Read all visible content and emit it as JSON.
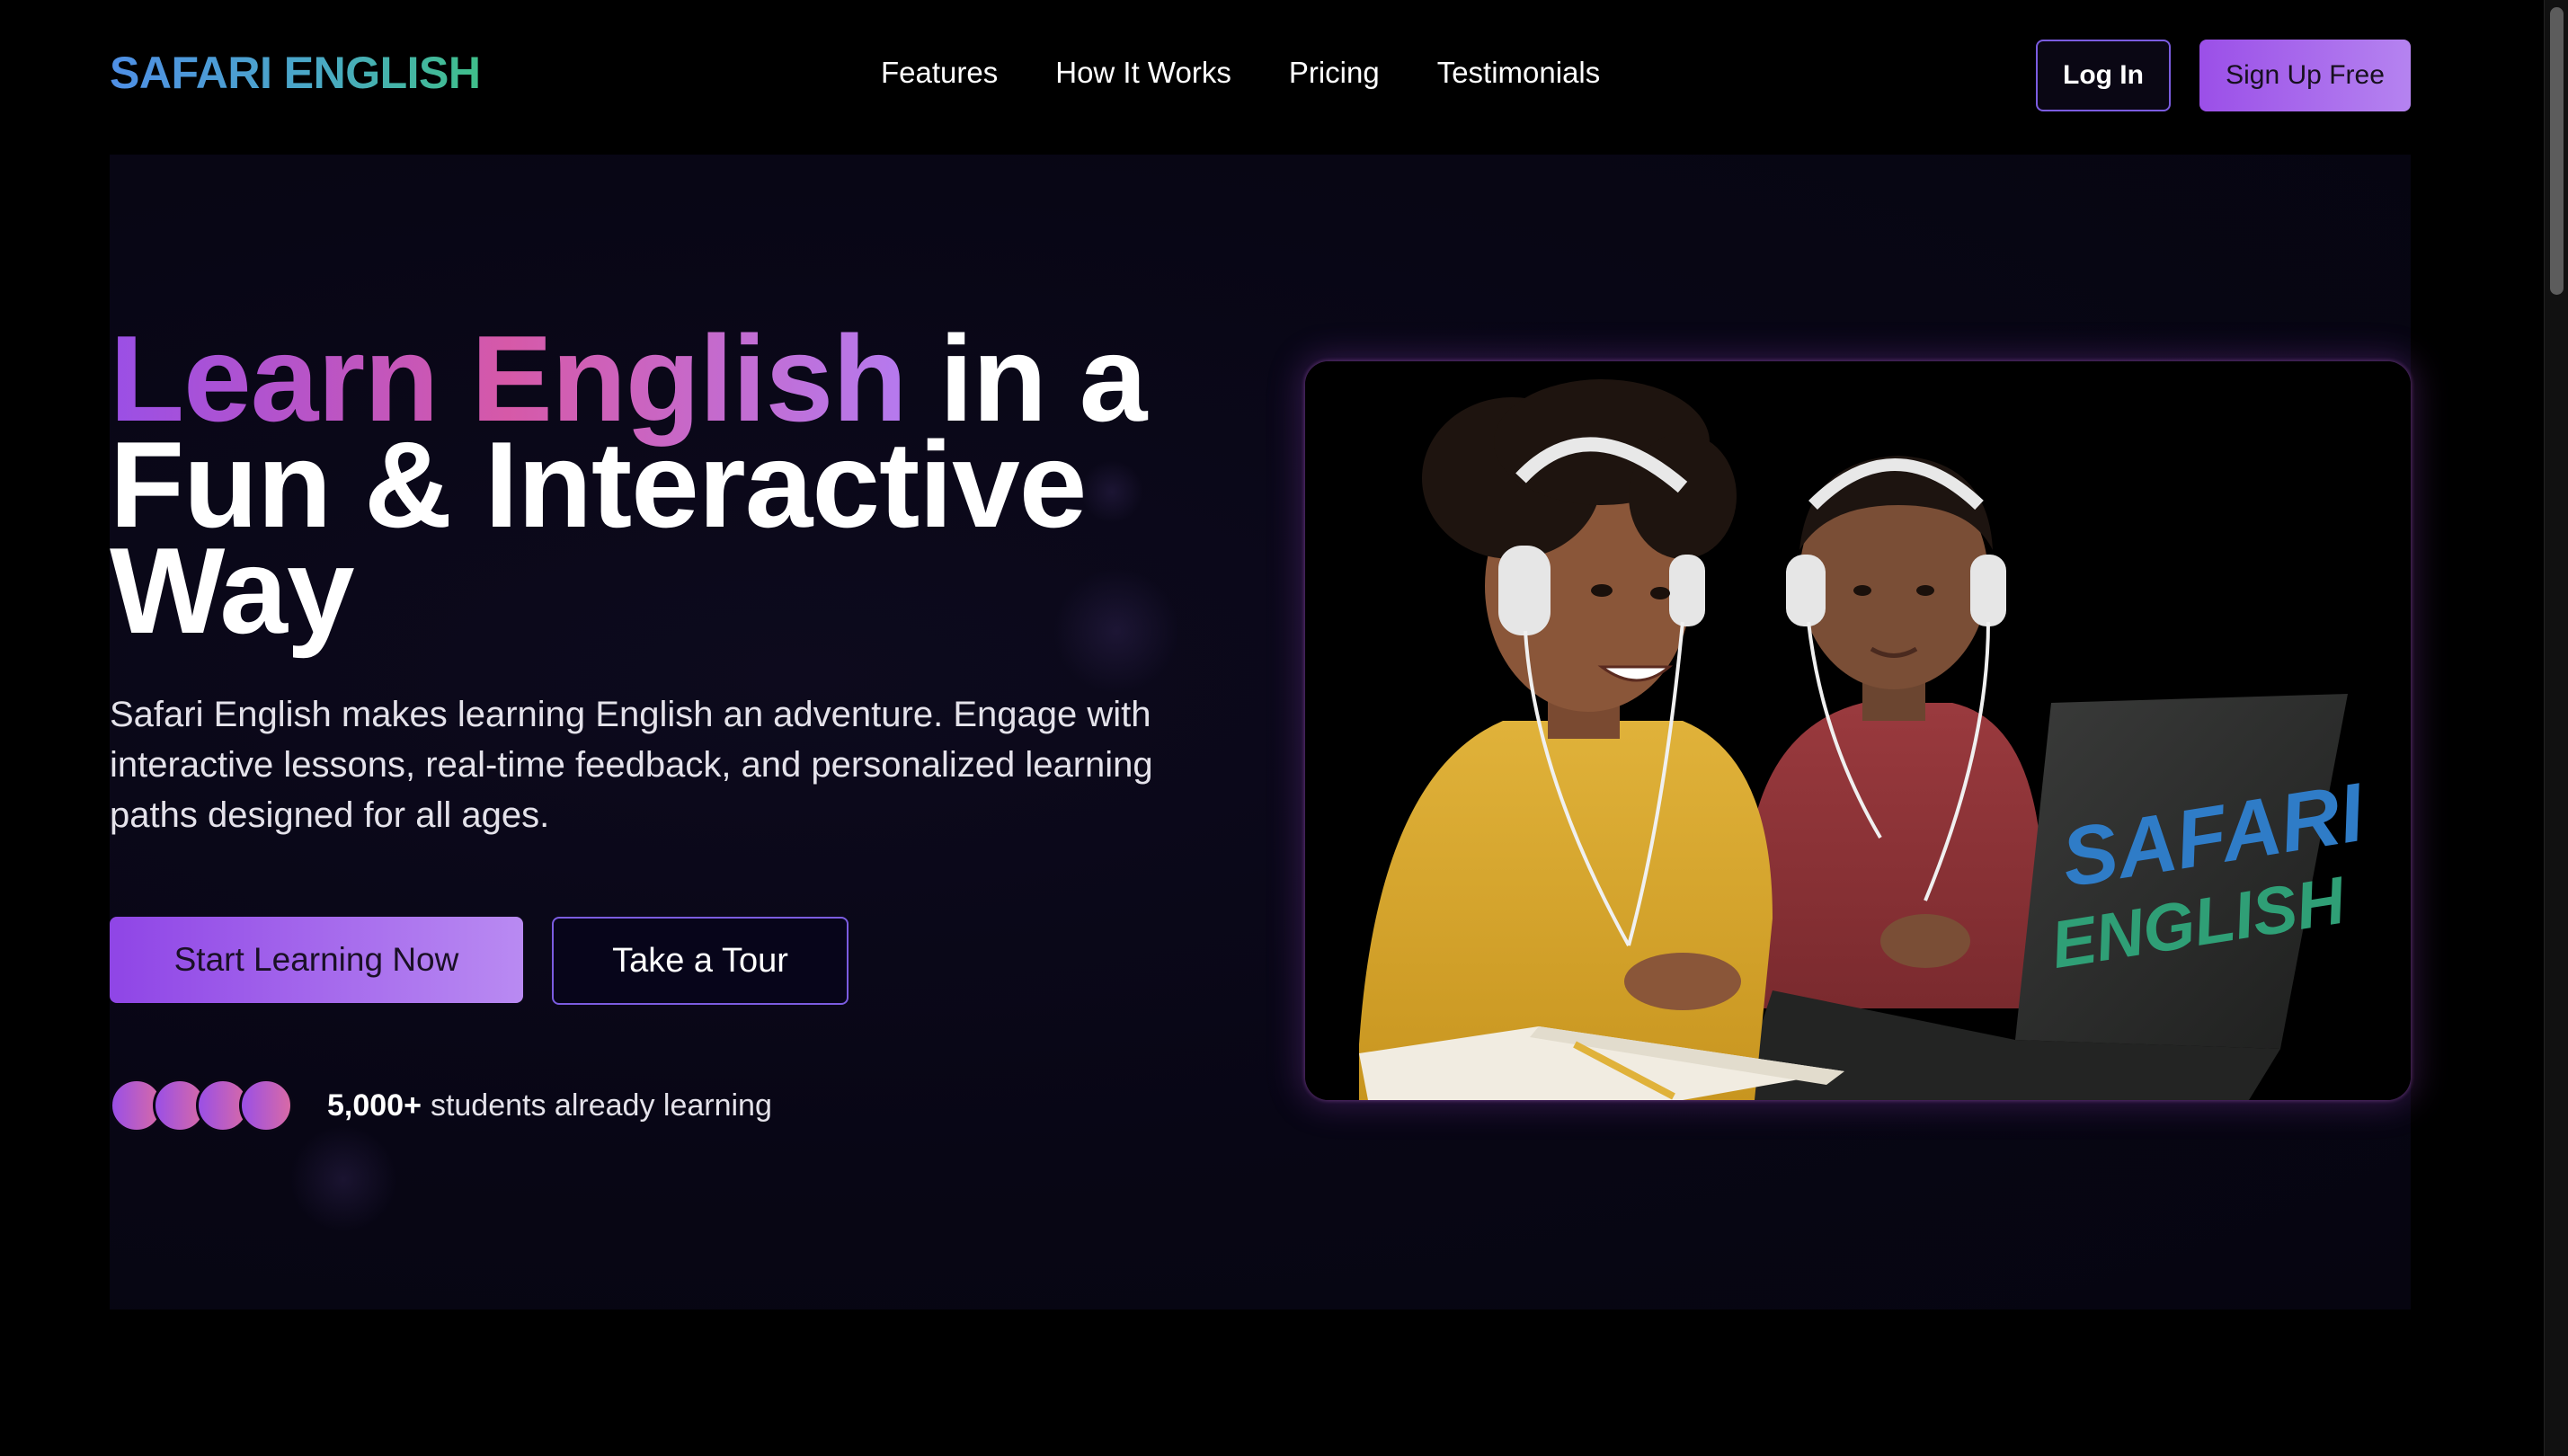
{
  "brand": {
    "logo_text": "SAFARI ENGLISH"
  },
  "nav": {
    "links": [
      "Features",
      "How It Works",
      "Pricing",
      "Testimonials"
    ],
    "login_label": "Log In",
    "signup_label": "Sign Up Free"
  },
  "hero": {
    "headline_gradient": "Learn English",
    "headline_rest_1": " in a",
    "headline_rest_2": "Fun & Interactive",
    "headline_rest_3": "Way",
    "subtext": "Safari English makes learning English an adventure. Engage with interactive lessons, real-time feedback, and personalized learning paths designed for all ages.",
    "primary_cta": "Start Learning Now",
    "secondary_cta": "Take a Tour",
    "social_proof_count": "5,000+",
    "social_proof_text": "students already learning",
    "avatar_count": 4,
    "image_laptop_text_line1": "SAFARI",
    "image_laptop_text_line2": "ENGLISH"
  },
  "colors": {
    "background": "#000000",
    "accent_purple": "#9b4fe8",
    "accent_pink": "#d659a8",
    "logo_blue": "#4f8fe6",
    "logo_green": "#3fbf8a"
  },
  "icons": {
    "avatars": "gradient-circle-avatar"
  }
}
